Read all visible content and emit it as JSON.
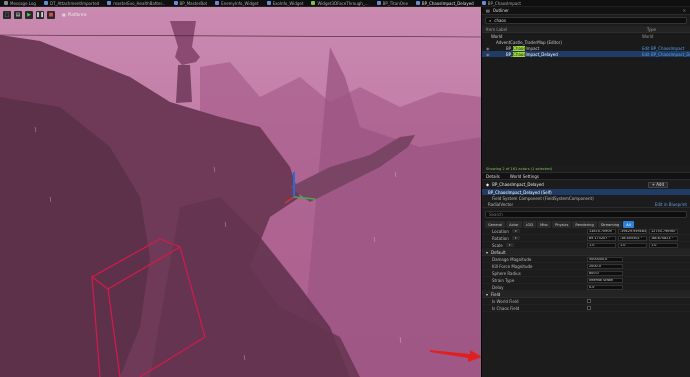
{
  "tabs": [
    {
      "label": "Message Log",
      "color": "#888888"
    },
    {
      "label": "DT_AttachmentImported",
      "color": "#6b8ad6"
    },
    {
      "label": "masterExo_HealthBatter...",
      "color": "#6b8ad6"
    },
    {
      "label": "BP_MasterBot",
      "color": "#6b8ad6"
    },
    {
      "label": "EnemyInfo_Widget",
      "color": "#6b8ad6"
    },
    {
      "label": "ExoInfo_Widget",
      "color": "#6b8ad6"
    },
    {
      "label": "Widget3DFaceThrough_...",
      "color": "#7cc04a"
    },
    {
      "label": "BP_TitanOne",
      "color": "#6b8ad6"
    },
    {
      "label": "BP_ChaosImpact_Delayed",
      "color": "#6b8ad6"
    },
    {
      "label": "BP_ChaosImpact",
      "color": "#6b8ad6"
    }
  ],
  "viewport": {
    "platforms_label": "Platforms"
  },
  "outliner": {
    "title": "Outliner",
    "search_value": "chaos",
    "col_item": "Item Label",
    "col_type": "Type",
    "rows": [
      {
        "eye": "",
        "label": "World",
        "type": "World",
        "indent": 0,
        "sel": false
      },
      {
        "eye": "",
        "label": "AdventCastle_TraderMap (Editor)",
        "type": "",
        "indent": 1,
        "sel": false
      },
      {
        "eye": "◉",
        "pre": "BP_",
        "hl": "Chaos",
        "post": "Impact",
        "type": "Edit BP_ChaosImpact",
        "indent": 3,
        "sel": false
      },
      {
        "eye": "◉",
        "pre": "BP_",
        "hl": "Chaos",
        "post": "Impact_Delayed",
        "type": "Edit BP_ChaosImpact_Delayed",
        "indent": 3,
        "sel": true
      }
    ],
    "count": "Showing 2 of 161 actors (1 selected)"
  },
  "details": {
    "tab_details": "Details",
    "tab_world": "World Settings",
    "actor_name": "BP_ChaosImpact_Delayed",
    "add_label": "+ Add",
    "comp_self": "BP_ChaosImpact_Delayed (Self)",
    "comp_field": "Field System Component (FieldSystemComponent)",
    "comp_radial": "RadialVector",
    "edit_bp": "Edit in Blueprint",
    "search_placeholder": "Search",
    "filter_tabs": [
      "General",
      "Actor",
      "LOD",
      "Misc",
      "Physics",
      "Rendering",
      "Streaming",
      "All"
    ],
    "transform": [
      {
        "label": "Location",
        "values": [
          "13874.70909",
          "-39429.959483",
          "12750.790987"
        ]
      },
      {
        "label": "Rotation",
        "values": [
          "89.175207 °",
          "-38.405502 °",
          "-88.670823 °"
        ]
      },
      {
        "label": "Scale",
        "values": [
          "1.0",
          "1.0",
          "1.0"
        ]
      }
    ],
    "default_section": "Default",
    "props": [
      {
        "label": "Damage Magnitude",
        "value": "5000000.0"
      },
      {
        "label": "Kill Force Magnitude",
        "value": "2000.0"
      },
      {
        "label": "Sphere Radius",
        "value": "800.0"
      },
      {
        "label": "Strain Type",
        "value": "Internal Strain"
      },
      {
        "label": "Delay",
        "value": "0.0"
      }
    ],
    "field_section": "Field",
    "field_props": [
      {
        "label": "Is World Field"
      },
      {
        "label": "Is Chaos Field"
      }
    ]
  }
}
